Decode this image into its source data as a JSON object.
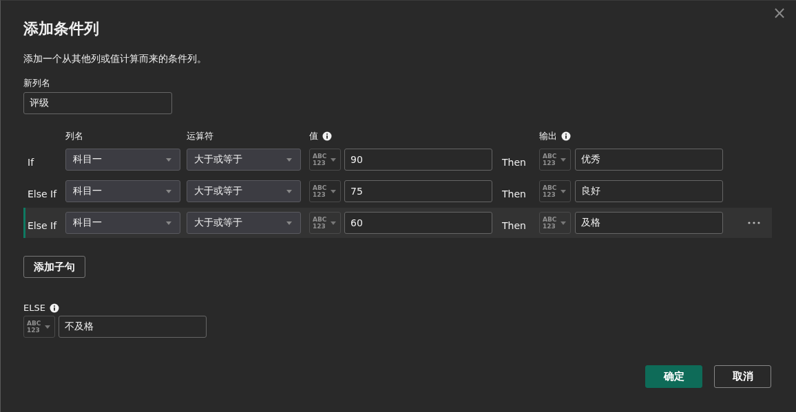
{
  "dialog": {
    "title": "添加条件列",
    "close_glyph": "×",
    "description": "添加一个从其他列或值计算而来的条件列。"
  },
  "new_column": {
    "label": "新列名",
    "value": "评级"
  },
  "headers": {
    "column": "列名",
    "operator": "运算符",
    "value": "值",
    "output": "输出"
  },
  "clauses": [
    {
      "keyword": "If",
      "column": "科目一",
      "operator": "大于或等于",
      "value_type": [
        "ABC",
        "123"
      ],
      "value": "90",
      "then": "Then",
      "output_type": [
        "ABC",
        "123"
      ],
      "output": "优秀",
      "selected": false
    },
    {
      "keyword": "Else If",
      "column": "科目一",
      "operator": "大于或等于",
      "value_type": [
        "ABC",
        "123"
      ],
      "value": "75",
      "then": "Then",
      "output_type": [
        "ABC",
        "123"
      ],
      "output": "良好",
      "selected": false
    },
    {
      "keyword": "Else If",
      "column": "科目一",
      "operator": "大于或等于",
      "value_type": [
        "ABC",
        "123"
      ],
      "value": "60",
      "then": "Then",
      "output_type": [
        "ABC",
        "123"
      ],
      "output": "及格",
      "selected": true
    }
  ],
  "add_clause_button": "添加子句",
  "else": {
    "label": "ELSE",
    "type": [
      "ABC",
      "123"
    ],
    "value": "不及格"
  },
  "buttons": [
    {
      "label": "确定",
      "kind": "primary"
    },
    {
      "label": "取消",
      "kind": "secondary"
    }
  ]
}
